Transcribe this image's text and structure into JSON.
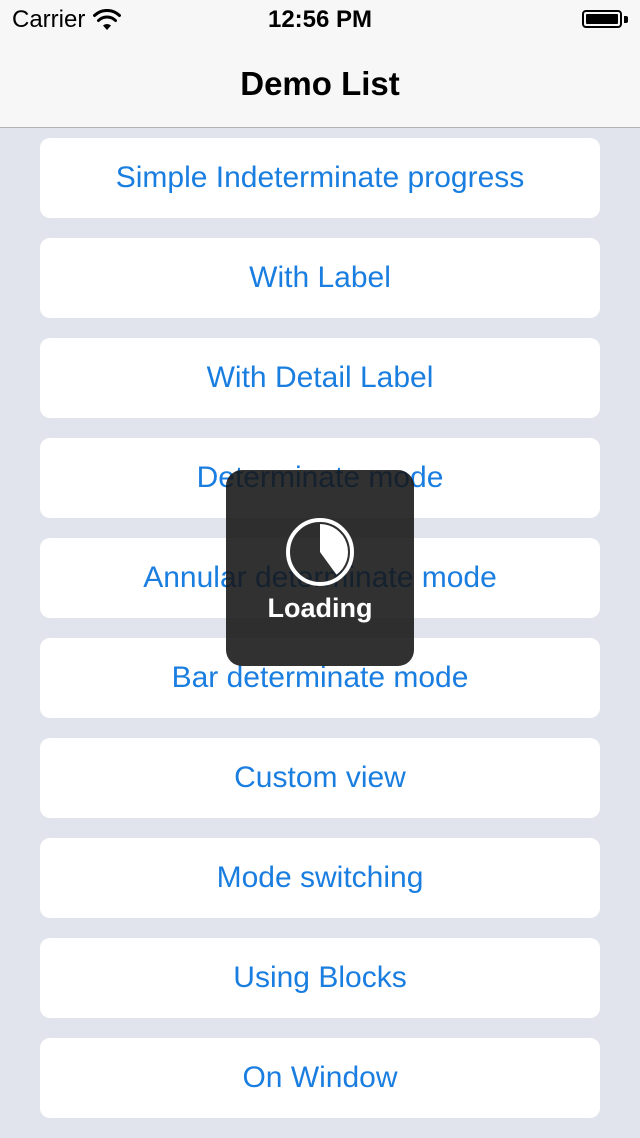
{
  "status_bar": {
    "carrier": "Carrier",
    "time": "12:56 PM",
    "wifi_icon": "wifi-icon",
    "battery_icon": "battery-icon"
  },
  "nav": {
    "title": "Demo List"
  },
  "list": {
    "items": [
      {
        "label": "Simple Indeterminate progress"
      },
      {
        "label": "With Label"
      },
      {
        "label": "With Detail Label"
      },
      {
        "label": "Determinate mode"
      },
      {
        "label": "Annular determinate mode"
      },
      {
        "label": "Bar determinate mode"
      },
      {
        "label": "Custom view"
      },
      {
        "label": "Mode switching"
      },
      {
        "label": "Using Blocks"
      },
      {
        "label": "On Window"
      }
    ]
  },
  "hud": {
    "label": "Loading",
    "icon": "pie-progress-icon",
    "progress": 0.4
  },
  "colors": {
    "accent": "#1a7ee0",
    "background": "#e1e4ec",
    "bar": "#f7f7f7",
    "hud": "#141414"
  }
}
